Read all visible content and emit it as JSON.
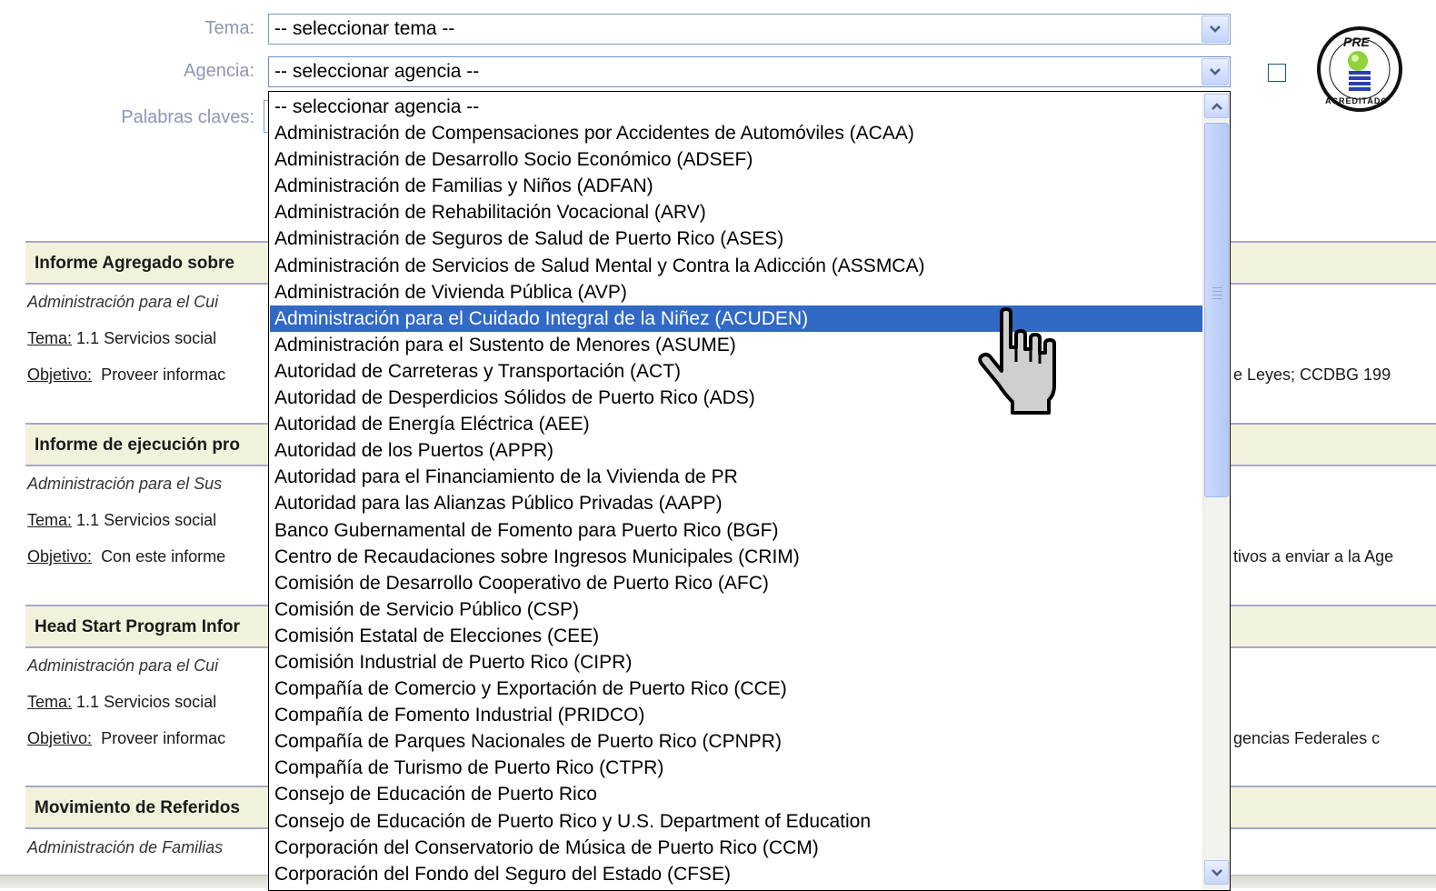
{
  "form": {
    "tema_label": "Tema:",
    "tema_value": "-- seleccionar tema --",
    "agencia_label": "Agencia:",
    "agencia_value": "-- seleccionar agencia --",
    "palabras_label": "Palabras claves:"
  },
  "logo": {
    "top_text": "PRE",
    "bottom_text": "ACREDITADO"
  },
  "results": [
    {
      "title": "Informe Agregado sobre",
      "agency": "Administración para el Cui",
      "tema_label": "Tema:",
      "tema_value": "1.1 Servicios social",
      "objetivo_label": "Objetivo:",
      "objetivo_value": "Proveer informac",
      "objetivo_tail": "e Leyes; CCDBG 199"
    },
    {
      "title": "Informe de ejecución pro",
      "agency": "Administración para el Sus",
      "tema_label": "Tema:",
      "tema_value": "1.1 Servicios social",
      "objetivo_label": "Objetivo:",
      "objetivo_value": "Con este informe",
      "objetivo_tail": "tivos a enviar a la Age"
    },
    {
      "title": "Head Start Program Infor",
      "agency": "Administración para el Cui",
      "tema_label": "Tema:",
      "tema_value": "1.1 Servicios social",
      "objetivo_label": "Objetivo:",
      "objetivo_value": "Proveer informac",
      "objetivo_tail": "gencias Federales c"
    },
    {
      "title": "Movimiento de Referidos",
      "agency": "Administración de Familias"
    }
  ],
  "dropdown": {
    "selected_index": 8,
    "options": [
      "-- seleccionar agencia --",
      "Administración de Compensaciones por Accidentes de Automóviles (ACAA)",
      "Administración de Desarrollo Socio Económico (ADSEF)",
      "Administración de Familias y Niños (ADFAN)",
      "Administración de Rehabilitación Vocacional (ARV)",
      "Administración de Seguros de Salud de Puerto Rico (ASES)",
      "Administración de Servicios de Salud Mental y Contra la Adicción (ASSMCA)",
      "Administración de Vivienda Pública (AVP)",
      "Administración para el Cuidado Integral de la Niñez (ACUDEN)",
      "Administración para el Sustento de Menores (ASUME)",
      "Autoridad de Carreteras y Transportación (ACT)",
      "Autoridad de Desperdicios Sólidos de Puerto Rico (ADS)",
      "Autoridad de Energía Eléctrica (AEE)",
      "Autoridad de los Puertos (APPR)",
      "Autoridad para el Financiamiento de la Vivienda de PR",
      "Autoridad para las Alianzas Público Privadas (AAPP)",
      "Banco Gubernamental de Fomento para Puerto Rico (BGF)",
      "Centro de Recaudaciones sobre Ingresos Municipales (CRIM)",
      "Comisión de Desarrollo Cooperativo de Puerto Rico (AFC)",
      "Comisión de Servicio Público (CSP)",
      "Comisión Estatal de Elecciones (CEE)",
      "Comisión Industrial de Puerto Rico (CIPR)",
      "Compañía de Comercio y Exportación de Puerto Rico (CCE)",
      "Compañía de Fomento Industrial (PRIDCO)",
      "Compañía de Parques Nacionales de Puerto Rico (CPNPR)",
      "Compañía de Turismo de Puerto Rico (CTPR)",
      "Consejo de Educación de Puerto Rico",
      "Consejo de Educación de Puerto Rico y U.S. Department of Education",
      "Corporación del Conservatorio de Música de Puerto Rico (CCM)",
      "Corporación del Fondo del Seguro del Estado (CFSE)"
    ]
  },
  "colors": {
    "highlight": "#316ac5",
    "section_bg": "#f2f2dc",
    "label": "#8f96b6"
  },
  "icons": [
    "chevron-down-icon",
    "chevron-up-icon",
    "hand-pointer-icon",
    "pre-acreditado-logo"
  ]
}
